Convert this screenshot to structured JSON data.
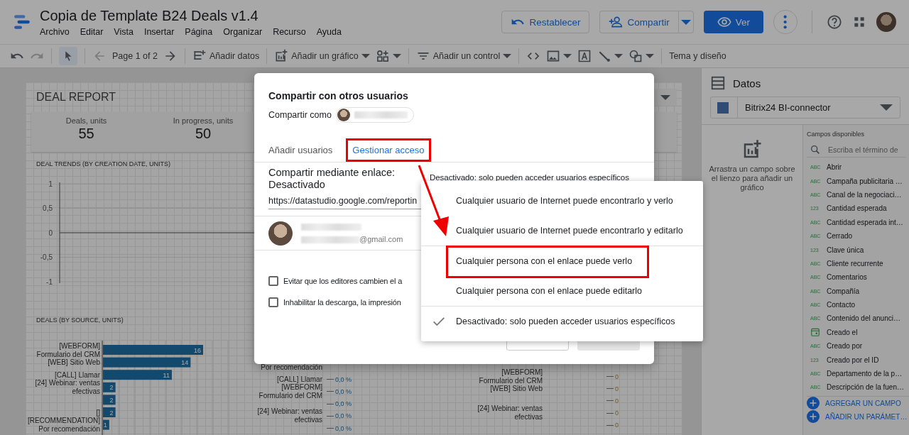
{
  "app": {
    "title": "Copia de Template B24 Deals v1.4",
    "menu": [
      "Archivo",
      "Editar",
      "Vista",
      "Insertar",
      "Página",
      "Organizar",
      "Recurso",
      "Ayuda"
    ],
    "reset_button": "Restablecer",
    "share_button": "Compartir",
    "view_button": "Ver"
  },
  "toolbar": {
    "page": "Page 1 of 2",
    "add_data": "Añadir datos",
    "add_chart": "Añadir un gráfico",
    "add_control": "Añadir un control",
    "theme": "Tema y diseño"
  },
  "report": {
    "title": "DEAL REPORT",
    "kpis": [
      {
        "label": "Deals, units",
        "value": "55"
      },
      {
        "label": "In progress, units",
        "value": "50"
      }
    ],
    "trend": {
      "title": "DEAL TRENDS (BY CREATION DATE, UNITS)",
      "y_labels": [
        "1",
        "0,5",
        "0",
        "-0,5",
        "-1"
      ]
    },
    "sources": {
      "title": "DEALS (BY SOURCE, UNITS)",
      "chart_data": {
        "type": "bar",
        "orientation": "horizontal",
        "data_labels": true,
        "categories": [
          "[WEBFORM] Formulario del CRM",
          "[WEB] Sitio Web",
          "[CALL] Llamar",
          "[24] Webinar: ventas efectivas",
          null,
          "[]",
          "[RECOMMENDATION] Por recomendación"
        ],
        "values": [
          16,
          14,
          11,
          2,
          2,
          2,
          1
        ]
      }
    },
    "panel_2": {
      "rows": [
        {
          "label": "Por recomendación"
        },
        {
          "label": "[CALL] Llamar",
          "value": "0,0 %"
        },
        {
          "label": "[WEBFORM] Formulario del CRM",
          "value": "0,0 %"
        },
        {
          "value": "0,0 %"
        },
        {
          "label": "[24] Webinar: ventas efectivas",
          "value": "0,0 %"
        },
        {
          "value": "0,0 %"
        }
      ]
    },
    "panel_3": {
      "rows": [
        {
          "label": "[WEBFORM] Formulario del CRM",
          "value": "0"
        },
        {
          "label": "[WEB] Sitio Web",
          "value": "0"
        },
        {
          "value": "0"
        },
        {
          "label": "[24] Webinar: ventas efectivas",
          "value": "0"
        },
        {
          "value": "0"
        }
      ]
    }
  },
  "data_panel": {
    "title": "Datos",
    "source": "Bitrix24 BI-connector",
    "hint": "Arrastra un campo sobre el lienzo para añadir un gráfico",
    "fields_title": "Campos disponibles",
    "search": {
      "placeholder": "Escriba el término de"
    },
    "fields": [
      {
        "kind": "text",
        "badge": "ABC",
        "name": "Abrir"
      },
      {
        "kind": "text",
        "badge": "ABC",
        "name": "Campaña publicitaria …"
      },
      {
        "kind": "text",
        "badge": "ABC",
        "name": "Canal de la negociaci…"
      },
      {
        "kind": "number",
        "badge": "123",
        "name": "Cantidad esperada"
      },
      {
        "kind": "text",
        "badge": "ABC",
        "name": "Cantidad esperada int…"
      },
      {
        "kind": "text",
        "badge": "ABC",
        "name": "Cerrado"
      },
      {
        "kind": "number",
        "badge": "123",
        "name": "Clave única"
      },
      {
        "kind": "text",
        "badge": "ABC",
        "name": "Cliente recurrente"
      },
      {
        "kind": "text",
        "badge": "ABC",
        "name": "Comentarios"
      },
      {
        "kind": "text",
        "badge": "ABC",
        "name": "Compañía"
      },
      {
        "kind": "text",
        "badge": "ABC",
        "name": "Contacto"
      },
      {
        "kind": "text",
        "badge": "ABC",
        "name": "Contenido del anunci…"
      },
      {
        "kind": "date",
        "name": "Creado el"
      },
      {
        "kind": "text",
        "badge": "ABC",
        "name": "Creado por"
      },
      {
        "kind": "number",
        "badge": "123",
        "name": "Creado por el ID"
      },
      {
        "kind": "text",
        "badge": "ABC",
        "name": "Departamento de la p…"
      },
      {
        "kind": "text",
        "badge": "ABC",
        "name": "Descripción de la fuen…"
      }
    ],
    "actions": [
      "AGREGAR UN CAMPO",
      "AÑADIR UN PARÁMET…"
    ]
  },
  "dialog": {
    "title": "Compartir con otros usuarios",
    "share_as": "Compartir como",
    "tabs": [
      {
        "label": "Añadir usuarios",
        "selected": false,
        "highlighted": false
      },
      {
        "label": "Gestionar acceso",
        "selected": true,
        "highlighted": true
      }
    ],
    "link_sharing": "Compartir mediante enlace: Desactivado",
    "access_value": "Desactivado: solo pueden acceder usuarios específicos",
    "url": "https://datastudio.google.com/reportin",
    "email_domain": "@gmail.com",
    "options": [
      {
        "label": "Evitar que los editores cambien el a",
        "checked": false
      },
      {
        "label": "Inhabilitar la descarga, la impresión",
        "checked": false
      }
    ]
  },
  "access_menu": {
    "items": [
      {
        "label": "Cualquier usuario de Internet puede encontrarlo y verlo",
        "selected": false,
        "highlighted": false
      },
      {
        "label": "Cualquier usuario de Internet puede encontrarlo y editarlo",
        "selected": false,
        "highlighted": false
      },
      {
        "label": "Cualquier persona con el enlace puede verlo",
        "selected": false,
        "highlighted": true
      },
      {
        "label": "Cualquier persona con el enlace puede editarlo",
        "selected": false,
        "highlighted": false
      },
      {
        "label": "Desactivado: solo pueden acceder usuarios específicos",
        "selected": true,
        "highlighted": false
      }
    ]
  }
}
